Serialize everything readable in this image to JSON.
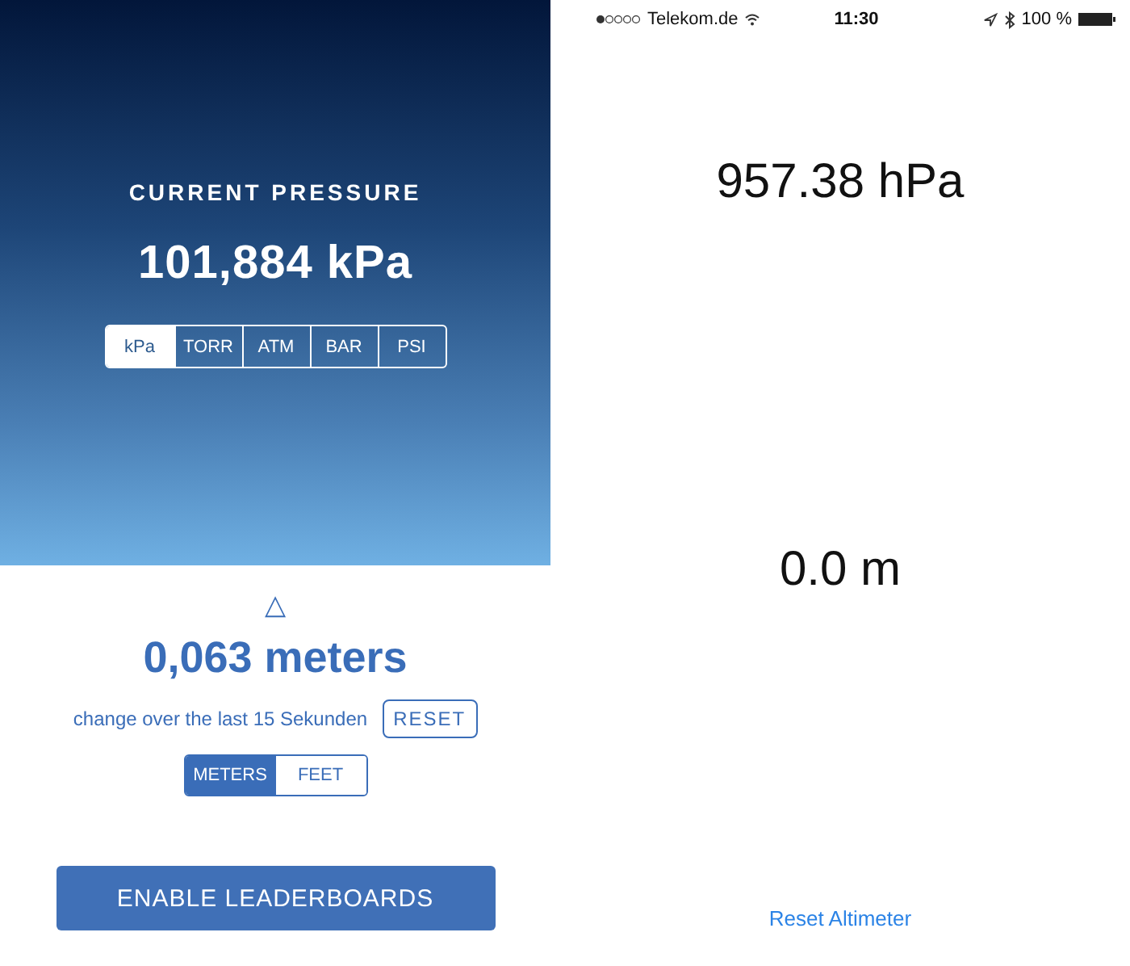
{
  "left_screen": {
    "pressure_title": "CURRENT PRESSURE",
    "pressure_value": "101,884 kPa",
    "units": [
      {
        "label": "kPa",
        "selected": true
      },
      {
        "label": "TORR",
        "selected": false
      },
      {
        "label": "ATM",
        "selected": false
      },
      {
        "label": "BAR",
        "selected": false
      },
      {
        "label": "PSI",
        "selected": false
      }
    ],
    "delta_symbol": "△",
    "change_value": "0,063 meters",
    "change_caption": "change over the last 15 Sekunden",
    "reset_button": "RESET",
    "distance_units": [
      {
        "label": "METERS",
        "selected": true
      },
      {
        "label": "FEET",
        "selected": false
      }
    ],
    "leaderboard_button": "ENABLE LEADERBOARDS"
  },
  "right_screen": {
    "status_bar": {
      "carrier": "Telekom.de",
      "time": "11:30",
      "battery": "100 %"
    },
    "pressure": "957.38 hPa",
    "altitude": "0.0 m",
    "reset_link": "Reset Altimeter"
  }
}
